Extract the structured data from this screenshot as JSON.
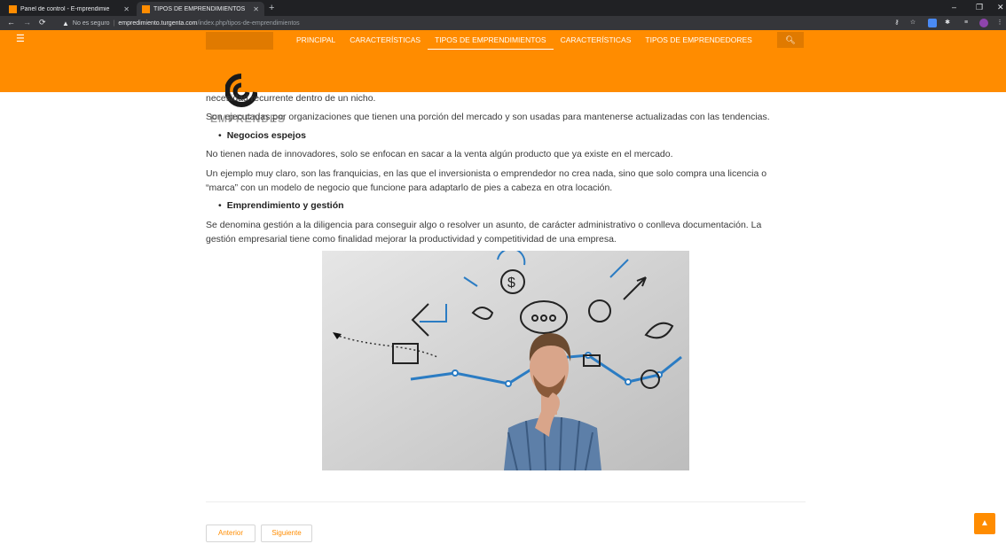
{
  "browser": {
    "tabs": [
      {
        "title": "Panel de control - E-mprendimie",
        "active": false
      },
      {
        "title": "TIPOS DE EMPRENDIMIENTOS",
        "active": true
      }
    ],
    "new_tab": "+",
    "security_label": "No es seguro",
    "url_host": "empredimiento.turgenta.com",
    "url_path": "/index.php/tipos-de-emprendimientos"
  },
  "site": {
    "logo_text": "EMPRENDES",
    "nav": [
      "PRINCIPAL",
      "CARACTERÍSTICAS",
      "TIPOS DE EMPRENDIMIENTOS",
      "CARACTERÍSTICAS",
      "TIPOS DE EMPRENDEDORES"
    ],
    "active_nav": "TIPOS DE EMPRENDIMIENTOS"
  },
  "content": {
    "p1": "necesidad recurrente dentro de un nicho.",
    "p2": "Son ejecutadas por organizaciones que tienen una porción del mercado y son usadas para mantenerse actualizadas con las tendencias.",
    "h1": "Negocios espejos",
    "p3": "No tienen nada de innovadores, solo se enfocan en sacar a la venta algún producto que ya existe en el mercado.",
    "p4a": "Un ejemplo muy claro, son las franquicias, en las que el inversionista o emprendedor no crea nada, sino que solo compra una licencia o",
    "p4b": "“marca” con un modelo de negocio que funcione para adaptarlo de pies a cabeza en otra locación.",
    "h2": "Emprendimiento y gestión",
    "p5a": "Se denomina gestión a la diligencia para conseguir algo o resolver un asunto, de carácter administrativo o conlleva documentación. La",
    "p5b": "gestión empresarial tiene como finalidad mejorar la productividad y competitividad de una empresa."
  },
  "pager": {
    "prev": "Anterior",
    "next": "Siguiente"
  },
  "colors": {
    "accent": "#ff8c00",
    "chrome_dark": "#202124"
  }
}
